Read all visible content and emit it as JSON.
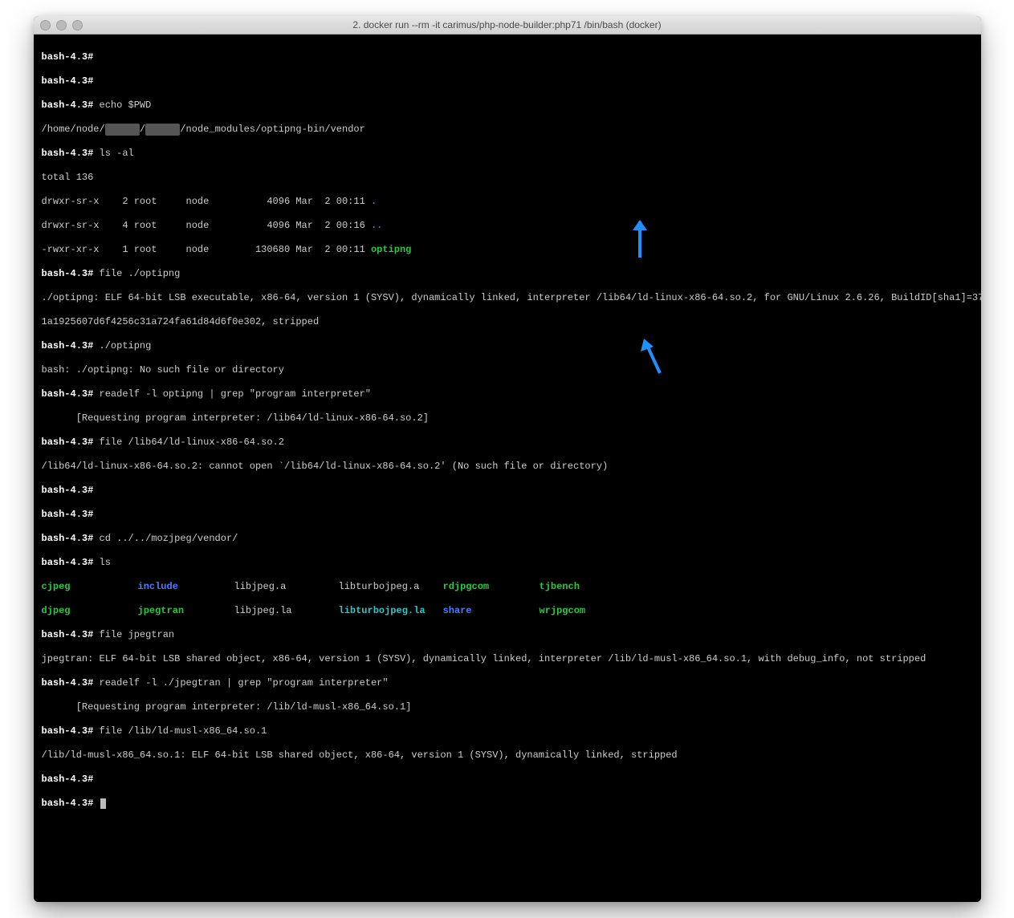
{
  "window": {
    "title": "2. docker run --rm -it carimus/php-node-builder:php71 /bin/bash (docker)"
  },
  "prompt": "bash-4.3#",
  "lines": {
    "l0": "echo $PWD",
    "pwd_prefix": "/home/node/",
    "pwd_mid": "/",
    "pwd_suffix": "/node_modules/optipng-bin/vendor",
    "l1": "ls -al",
    "total": "total 136",
    "ls1_perm": "drwxr-sr-x    2 root     node          4096 Mar  2 00:11 ",
    "ls1_name": ".",
    "ls2_perm": "drwxr-sr-x    4 root     node          4096 Mar  2 00:16 ",
    "ls2_name": "..",
    "ls3_perm": "-rwxr-xr-x    1 root     node        130680 Mar  2 00:11 ",
    "ls3_name": "optipng",
    "l2": "file ./optipng",
    "file1a": "./optipng: ELF 64-bit LSB executable, x86-64, version 1 (SYSV), dynamically linked, interpreter /lib64/ld-linux-x86-64.so.2, for GNU/Linux 2.6.26, BuildID[sha1]=37",
    "file1b": "1a1925607d6f4256c31a724fa61d84d6f0e302, stripped",
    "l3": "./optipng",
    "err1": "bash: ./optipng: No such file or directory",
    "l4": "readelf -l optipng | grep \"program interpreter\"",
    "req1": "      [Requesting program interpreter: /lib64/ld-linux-x86-64.so.2]",
    "l5": "file /lib64/ld-linux-x86-64.so.2",
    "err2": "/lib64/ld-linux-x86-64.so.2: cannot open `/lib64/ld-linux-x86-64.so.2' (No such file or directory)",
    "l6": "cd ../../mozjpeg/vendor/",
    "l7": "ls",
    "ls_r1_c1": "cjpeg",
    "ls_r1_c2": "include",
    "ls_r1_c3": "libjpeg.a",
    "ls_r1_c4": "libturbojpeg.a",
    "ls_r1_c5": "rdjpgcom",
    "ls_r1_c6": "tjbench",
    "ls_r2_c1": "djpeg",
    "ls_r2_c2": "jpegtran",
    "ls_r2_c3": "libjpeg.la",
    "ls_r2_c4": "libturbojpeg.la",
    "ls_r2_c5": "share",
    "ls_r2_c6": "wrjpgcom",
    "l8": "file jpegtran",
    "file2": "jpegtran: ELF 64-bit LSB shared object, x86-64, version 1 (SYSV), dynamically linked, interpreter /lib/ld-musl-x86_64.so.1, with debug_info, not stripped",
    "l9": "readelf -l ./jpegtran | grep \"program interpreter\"",
    "req2": "      [Requesting program interpreter: /lib/ld-musl-x86_64.so.1]",
    "l10": "file /lib/ld-musl-x86_64.so.1",
    "file3": "/lib/ld-musl-x86_64.so.1: ELF 64-bit LSB shared object, x86-64, version 1 (SYSV), dynamically linked, stripped"
  },
  "arrow_color": "#1e90ff"
}
